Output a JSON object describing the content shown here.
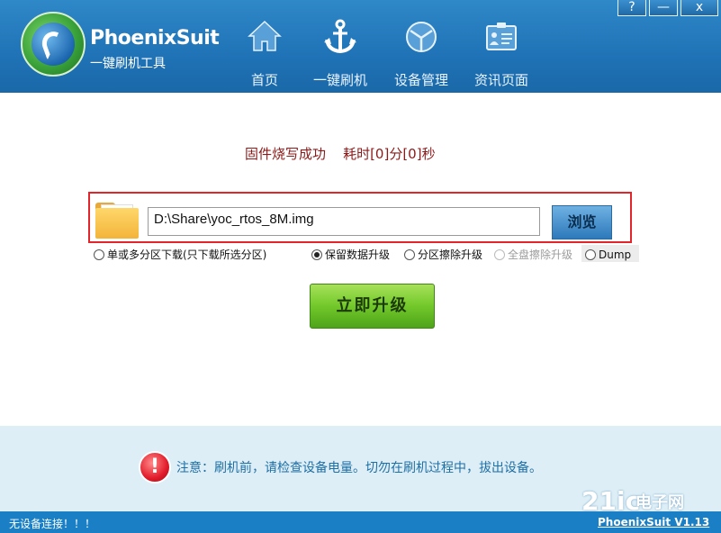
{
  "app": {
    "brand": "PhoenixSuit",
    "subtitle": "一键刷机工具"
  },
  "nav": [
    {
      "label": "首页",
      "icon": "home-icon"
    },
    {
      "label": "一键刷机",
      "icon": "anchor-icon"
    },
    {
      "label": "设备管理",
      "icon": "device-icon"
    },
    {
      "label": "资讯页面",
      "icon": "news-icon"
    }
  ],
  "window_controls": {
    "help": "?",
    "minimize": "—",
    "close": "x"
  },
  "main": {
    "status": "固件烧写成功    耗时[0]分[0]秒",
    "path_value": "D:\\Share\\yoc_rtos_8M.img",
    "browse_label": "浏览",
    "options": [
      {
        "label": "单或多分区下载(只下载所选分区)",
        "checked": false,
        "disabled": false
      },
      {
        "label": "保留数据升级",
        "checked": true,
        "disabled": false
      },
      {
        "label": "分区擦除升级",
        "checked": false,
        "disabled": false
      },
      {
        "label": "全盘擦除升级",
        "checked": false,
        "disabled": true
      },
      {
        "label": "Dump",
        "checked": false,
        "disabled": false
      }
    ],
    "upgrade_label": "立即升级"
  },
  "notice": {
    "icon_text": "!",
    "text": "注意：刷机前，请检查设备电量。切勿在刷机过程中，拔出设备。"
  },
  "statusbar": {
    "left": "无设备连接！！！",
    "right": "PhoenixSuit V1.13"
  },
  "watermark": {
    "main": "21ic",
    "small": "电子网"
  },
  "colors": {
    "header": "#1f73b6",
    "accent_red": "#e2242b",
    "status_text": "#8b1a1a",
    "notice_text": "#1f6fa5",
    "upgrade_green": "#72c82a"
  }
}
